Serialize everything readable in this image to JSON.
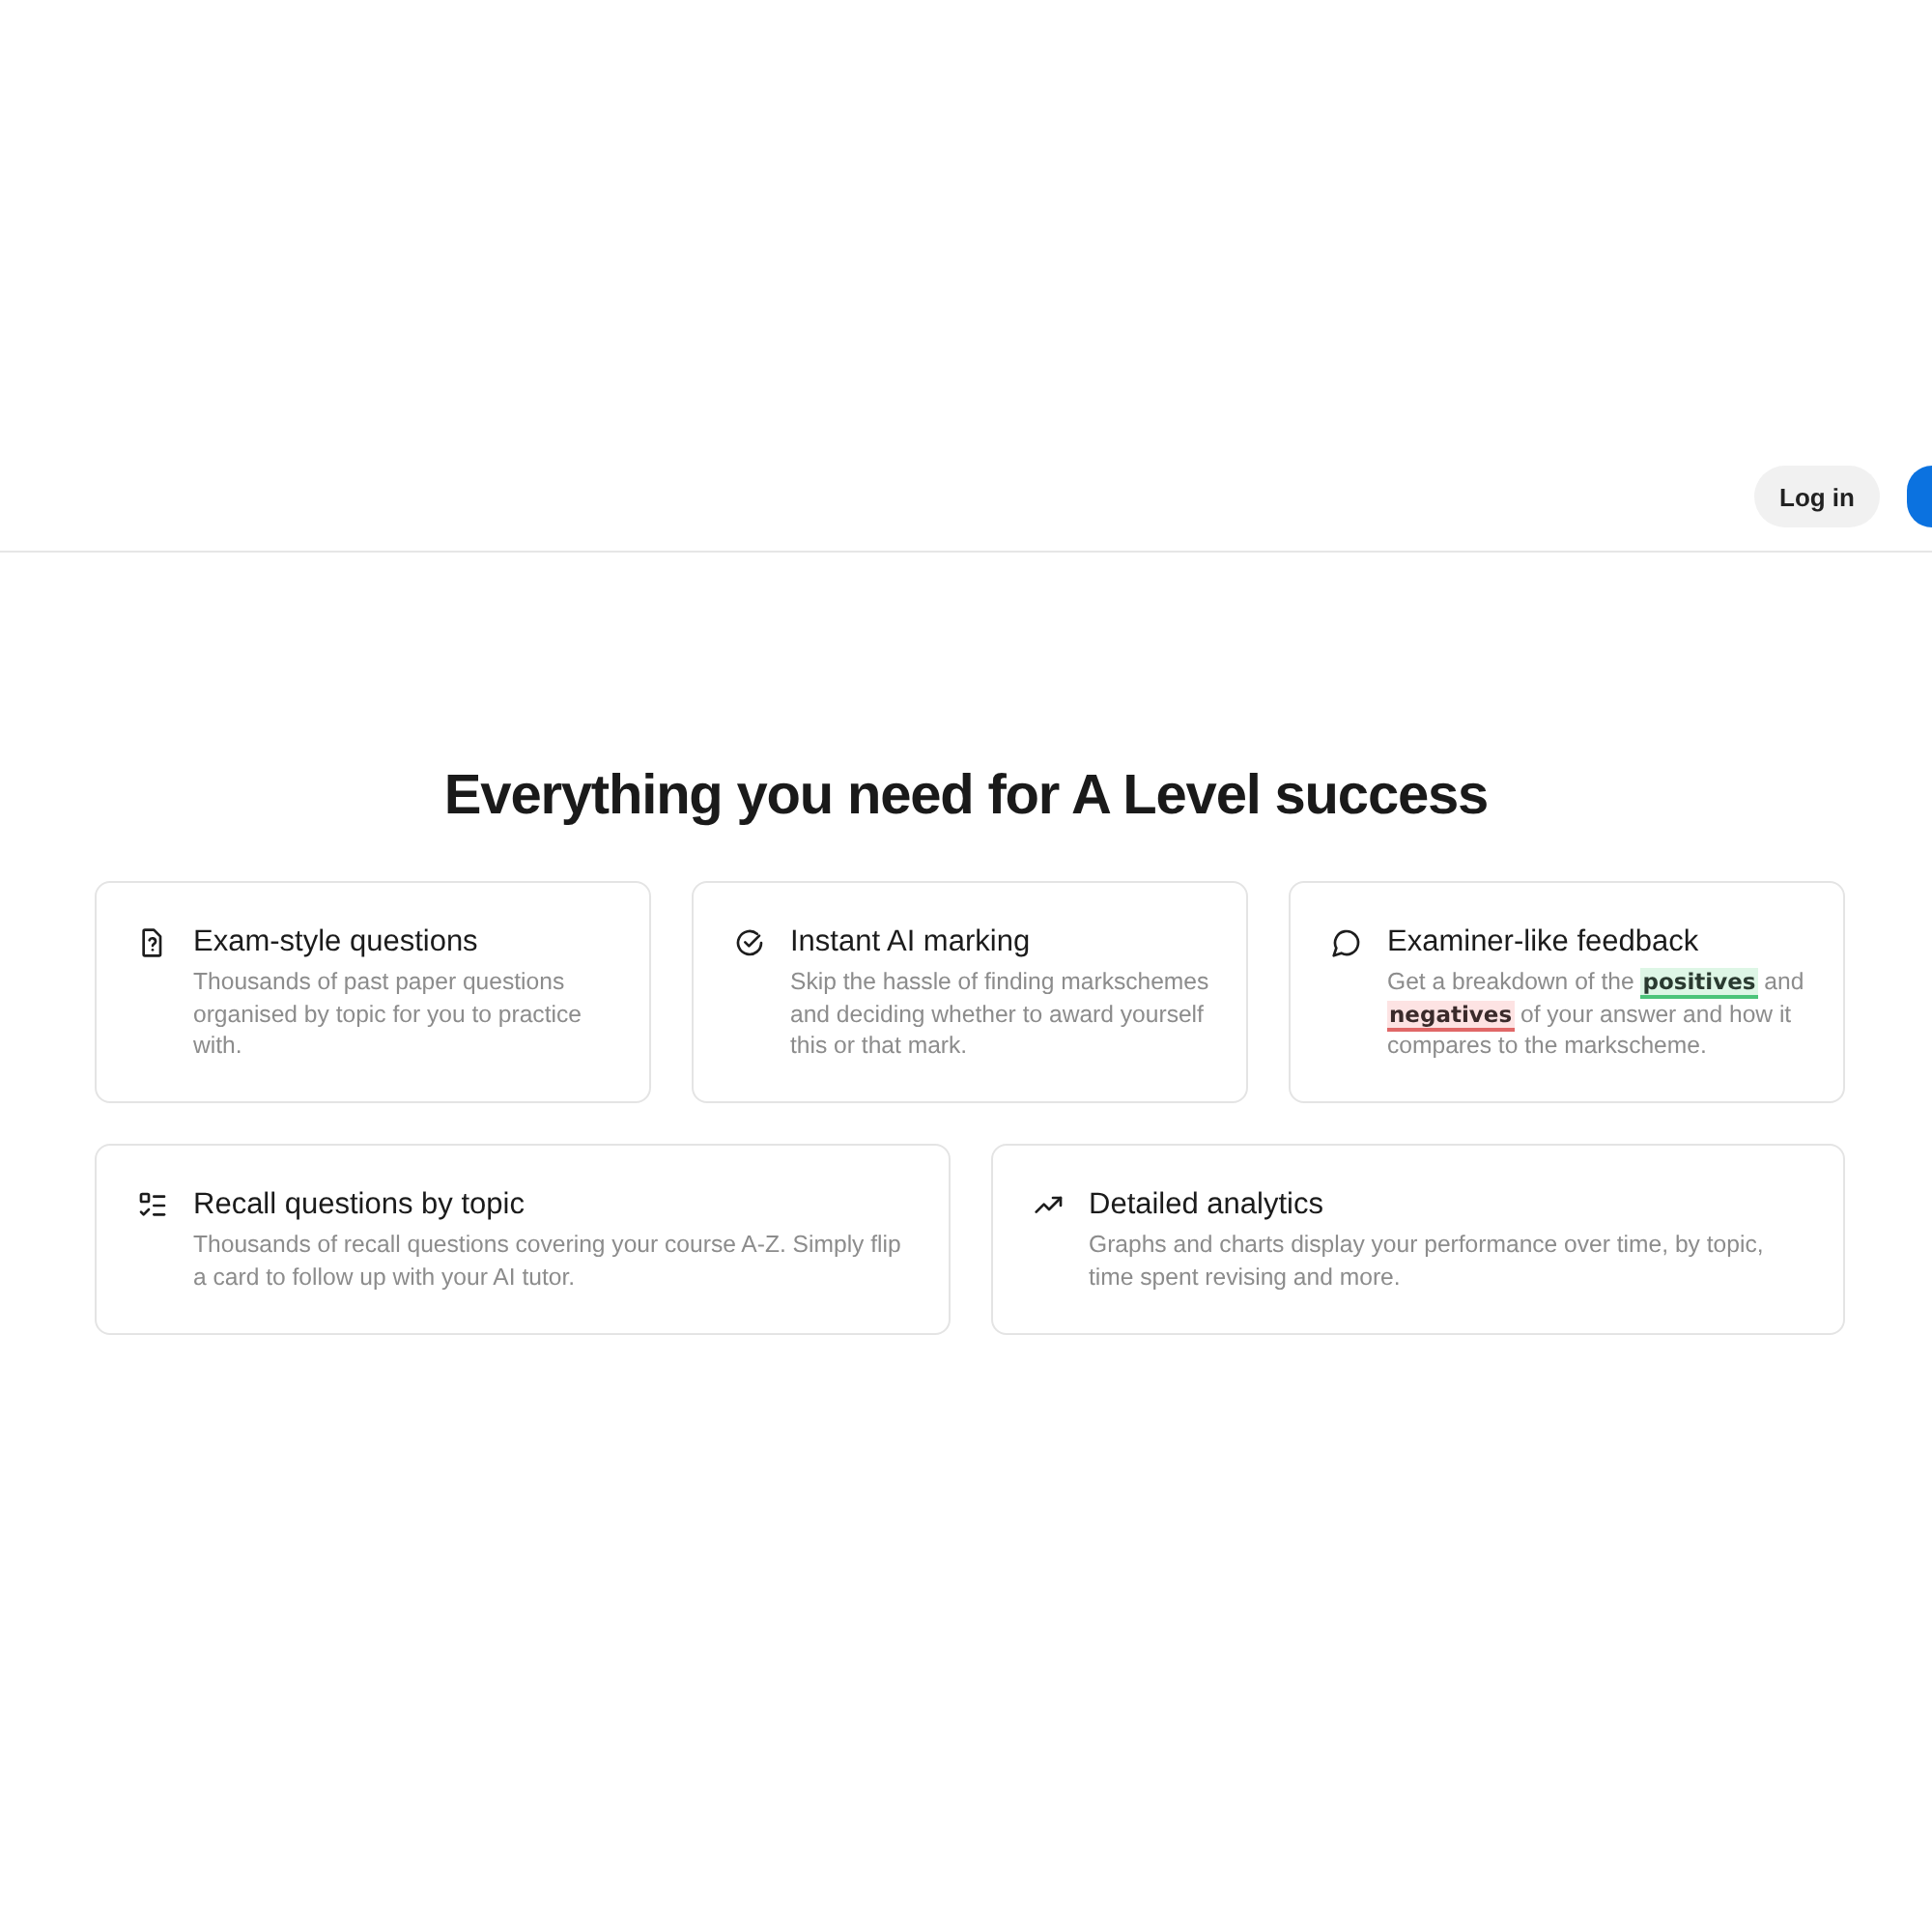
{
  "header": {
    "buttons": [
      {
        "kind": "secondary",
        "label": "Log in"
      },
      {
        "kind": "primary"
      }
    ]
  },
  "heading": "Everything you need for A Level success",
  "feature_rows": [
    {
      "cards": [
        {
          "title": "Exam-style questions",
          "description": [
            {
              "kind": "plain",
              "text": "Thousands of past paper questions organised by topic for you to practice with."
            }
          ]
        },
        {
          "title": "Instant AI marking",
          "description": [
            {
              "kind": "plain",
              "text": "Skip the hassle of finding markschemes and deciding whether to award yourself this or that mark."
            }
          ]
        },
        {
          "title": "Examiner-like feedback",
          "description": [
            {
              "kind": "plain",
              "text": "Get a breakdown of the "
            },
            {
              "kind": "positive",
              "text": "positives"
            },
            {
              "kind": "plain",
              "text": " and "
            },
            {
              "kind": "negative",
              "text": "negatives"
            },
            {
              "kind": "plain",
              "text": " of your answer and how it compares to the markscheme."
            }
          ]
        }
      ]
    },
    {
      "cards": [
        {
          "title": "Recall questions by topic",
          "description": [
            {
              "kind": "plain",
              "text": "Thousands of recall questions covering your course A-Z. Simply flip a card to follow up with your AI tutor."
            }
          ]
        },
        {
          "title": "Detailed analytics",
          "description": [
            {
              "kind": "plain",
              "text": "Graphs and charts display your performance over time, by topic, time spent revising and more."
            }
          ]
        }
      ]
    }
  ]
}
